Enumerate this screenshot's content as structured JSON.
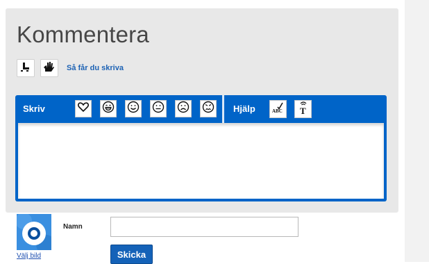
{
  "header": {
    "title": "Kommentera"
  },
  "toolbar": {
    "howto_link": "Så får du skriva",
    "icons": [
      "easy-read-icon",
      "sign-language-icon"
    ]
  },
  "editor": {
    "write_label": "Skriv",
    "help_label": "Hjälp",
    "emoji_buttons": [
      "heart-icon",
      "laughing-face-icon",
      "smiling-face-icon",
      "neutral-face-icon",
      "sad-face-icon",
      "angry-face-icon"
    ],
    "help_buttons": [
      "spellcheck-icon",
      "text-to-speech-icon"
    ],
    "textarea_value": ""
  },
  "form": {
    "choose_image_link": "Välj bild",
    "name_label": "Namn",
    "name_value": "",
    "submit_label": "Skicka"
  },
  "colors": {
    "accent": "#0064c8",
    "panel_bg": "#e8e8e8",
    "title": "#474747",
    "link": "#1d62b4"
  }
}
